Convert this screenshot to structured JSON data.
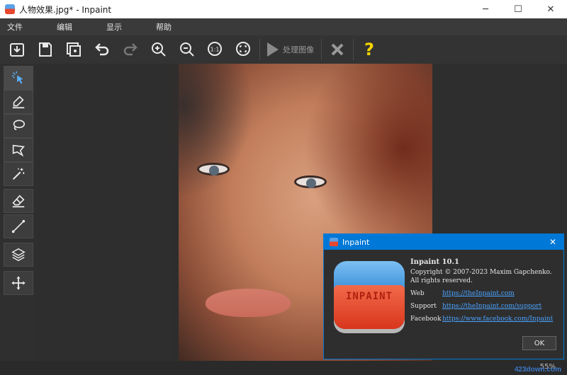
{
  "window": {
    "title": "人物效果.jpg* - Inpaint",
    "controls": {
      "minimize": "─",
      "maximize": "☐",
      "close": "✕"
    }
  },
  "menu": {
    "items": [
      "文件",
      "编辑",
      "显示",
      "帮助"
    ]
  },
  "toolbar": {
    "process_label": "处理图像",
    "help_glyph": "?",
    "zoom_actual_label": "1:1"
  },
  "statusbar": {
    "zoom": "55%"
  },
  "dialog": {
    "title": "Inpaint",
    "close": "✕",
    "product": "Inpaint 10.1",
    "copyright": "Copyright © 2007-2023 Maxim Gapchenko.",
    "rights": "All rights reserved.",
    "links": [
      {
        "label": "Web",
        "url": "https://theInpaint.com"
      },
      {
        "label": "Support",
        "url": "https://theInpaint.com/support"
      },
      {
        "label": "Facebook",
        "url": "https://www.facebook.com/Inpaint"
      }
    ],
    "logo_text": "INPAINT",
    "ok": "OK"
  },
  "watermark": "423down.com",
  "colors": {
    "accent": "#0078d7",
    "link": "#4aa3ff",
    "help": "#f5d400",
    "active_tool": "#5ab4ff"
  }
}
